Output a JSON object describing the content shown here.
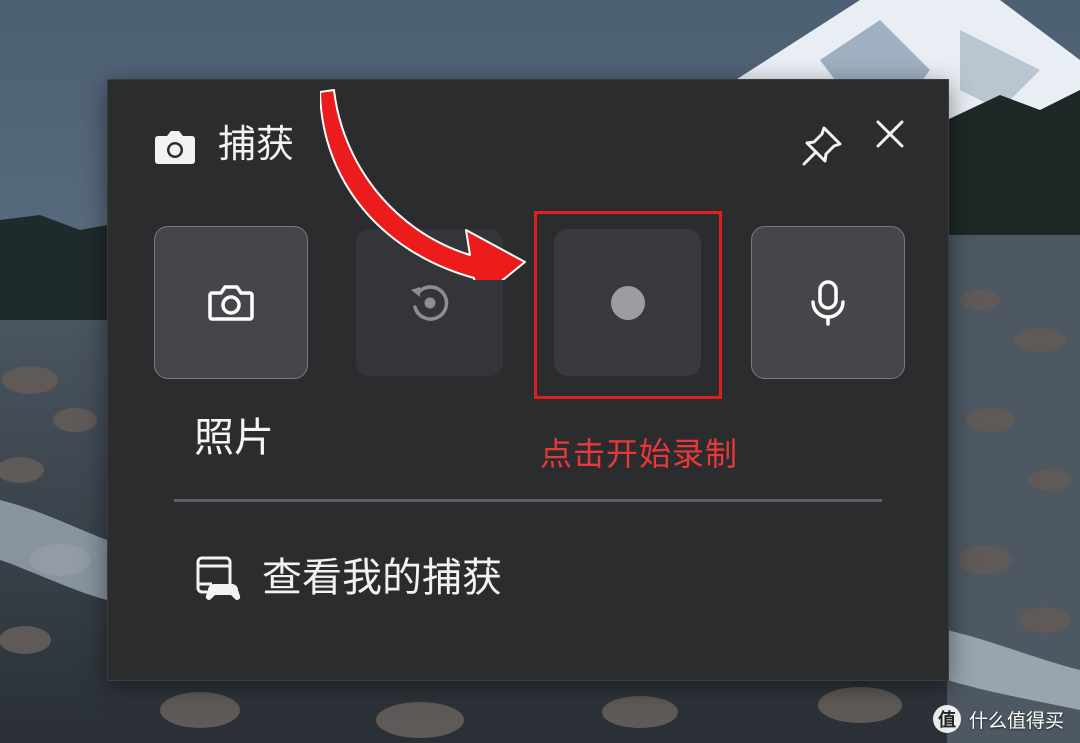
{
  "widget": {
    "title": "捕获",
    "title_icon": "camera-icon",
    "pin_icon": "pin-icon",
    "close_icon": "close-icon"
  },
  "capture_buttons": [
    {
      "id": "photo",
      "icon": "camera-icon",
      "state": "active"
    },
    {
      "id": "replay",
      "icon": "replay-icon",
      "state": "disabled"
    },
    {
      "id": "record",
      "icon": "record-dot-icon",
      "state": "idle"
    },
    {
      "id": "microphone",
      "icon": "microphone-icon",
      "state": "active"
    }
  ],
  "selected_label": "照片",
  "annotation": {
    "text": "点击开始录制",
    "color": "#e8383a"
  },
  "gallery_link": {
    "label": "查看我的捕获",
    "icon": "gallery-controller-icon"
  },
  "watermark": {
    "badge": "值",
    "text": "什么值得买"
  },
  "colors": {
    "panel_bg": "#2b2c2e",
    "highlight": "#e21d1d",
    "text": "#f2f2f2"
  }
}
